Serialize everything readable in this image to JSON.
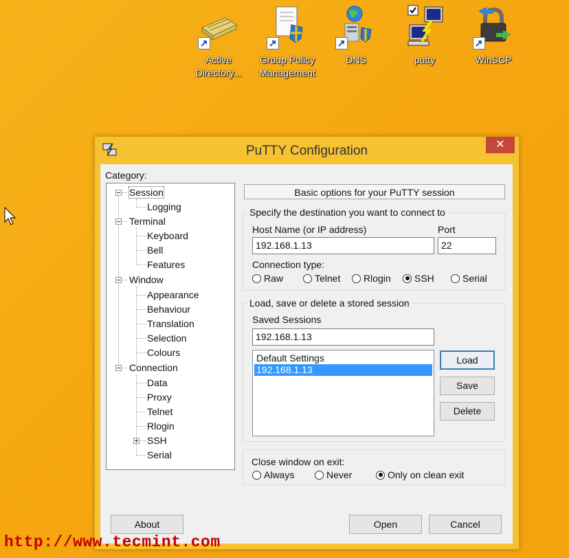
{
  "desktop": {
    "icons": [
      {
        "label": "Active Directory...",
        "icon": "active-directory-icon"
      },
      {
        "label": "Group Policy Management",
        "icon": "group-policy-icon"
      },
      {
        "label": "DNS",
        "icon": "dns-icon"
      },
      {
        "label": "putty",
        "icon": "putty-icon"
      },
      {
        "label": "WinSCP",
        "icon": "winscp-icon"
      }
    ]
  },
  "window": {
    "title": "PuTTY Configuration",
    "close_label": "✕"
  },
  "category": {
    "label": "Category:",
    "items": [
      "Session",
      "Logging",
      "Terminal",
      "Keyboard",
      "Bell",
      "Features",
      "Window",
      "Appearance",
      "Behaviour",
      "Translation",
      "Selection",
      "Colours",
      "Connection",
      "Data",
      "Proxy",
      "Telnet",
      "Rlogin",
      "SSH",
      "Serial"
    ],
    "selected": "Session"
  },
  "panel": {
    "header": "Basic options for your PuTTY session",
    "destination_title": "Specify the destination you want to connect to",
    "host_label": "Host Name (or IP address)",
    "host_value": "192.168.1.13",
    "port_label": "Port",
    "port_value": "22",
    "conn_type_label": "Connection type:",
    "conn_types": [
      "Raw",
      "Telnet",
      "Rlogin",
      "SSH",
      "Serial"
    ],
    "conn_selected": "SSH",
    "sessions_title": "Load, save or delete a stored session",
    "saved_label": "Saved Sessions",
    "saved_value": "192.168.1.13",
    "sessions": [
      "Default Settings",
      "192.168.1.13"
    ],
    "session_selected": "192.168.1.13",
    "load_label": "Load",
    "save_label": "Save",
    "delete_label": "Delete",
    "close_exit_label": "Close window on exit:",
    "exit_options": [
      "Always",
      "Never",
      "Only on clean exit"
    ],
    "exit_selected": "Only on clean exit"
  },
  "footer": {
    "about_label": "About",
    "open_label": "Open",
    "cancel_label": "Cancel"
  },
  "watermark": "http://www.tecmint.com",
  "colors": {
    "desktop": "#f7b21a",
    "window_frame": "#f6c232",
    "close_button": "#c7463a",
    "selection": "#3399ff",
    "watermark": "#c00000"
  }
}
